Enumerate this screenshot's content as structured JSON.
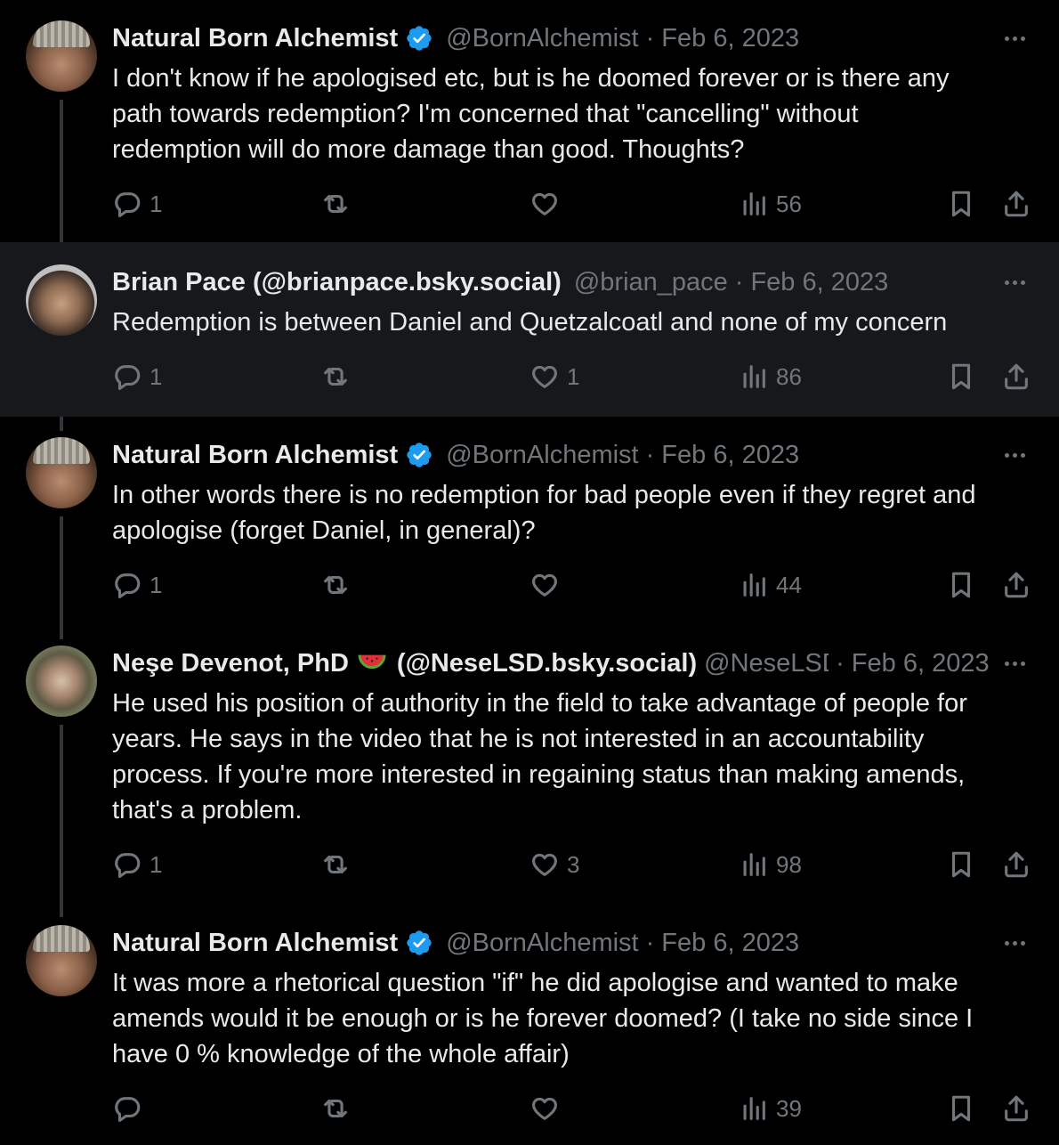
{
  "tweets": [
    {
      "name": "Natural Born Alchemist",
      "verified": true,
      "handle": "@BornAlchemist",
      "date": "Feb 6, 2023",
      "text": "I don't know if he apologised etc, but is he doomed forever or is there any\npath towards redemption? I'm concerned that \"cancelling\" without\nredemption will do more damage than good. Thoughts?",
      "replies": "1",
      "reposts": "",
      "likes": "",
      "views": "56"
    },
    {
      "name": "Brian Pace (@brianpace.bsky.social)",
      "verified": false,
      "handle": "@brian_pace",
      "date": "Feb 6, 2023",
      "text": "Redemption is between Daniel and Quetzalcoatl and none of my concern",
      "replies": "1",
      "reposts": "",
      "likes": "1",
      "views": "86"
    },
    {
      "name": "Natural Born Alchemist",
      "verified": true,
      "handle": "@BornAlchemist",
      "date": "Feb 6, 2023",
      "text": "In other words there is no redemption for bad people even if they regret and\napologise (forget Daniel, in general)?",
      "replies": "1",
      "reposts": "",
      "likes": "",
      "views": "44"
    },
    {
      "name": "Neşe Devenot, PhD",
      "name_suffix": "(@NeseLSD.bsky.social)",
      "verified": false,
      "handle": "@NeseLSD",
      "date": "Feb 6, 2023",
      "text": "He used his position of authority in the field to take advantage of people for\nyears. He says in the video that he is not interested in an accountability\nprocess. If you're more interested in regaining status than making amends,\nthat's a problem.",
      "replies": "1",
      "reposts": "",
      "likes": "3",
      "views": "98"
    },
    {
      "name": "Natural Born Alchemist",
      "verified": true,
      "handle": "@BornAlchemist",
      "date": "Feb 6, 2023",
      "text": "It was more a rhetorical question \"if\" he did apologise and wanted to make\namends would it be enough or is he forever doomed? (I take no side since I\nhave 0 % knowledge of the whole affair)",
      "replies": "",
      "reposts": "",
      "likes": "",
      "views": "39"
    }
  ],
  "icons": {
    "reply": "reply-icon",
    "repost": "repost-icon",
    "like": "heart-icon",
    "views": "analytics-icon",
    "bookmark": "bookmark-icon",
    "share": "share-icon",
    "verified": "verified-badge-icon",
    "more": "more-icon",
    "emoji": "watermelon-emoji"
  },
  "colors": {
    "background": "#000000",
    "highlight": "#16181c",
    "text": "#e7e9ea",
    "secondary": "#71767b",
    "verified": "#1d9bf0"
  }
}
